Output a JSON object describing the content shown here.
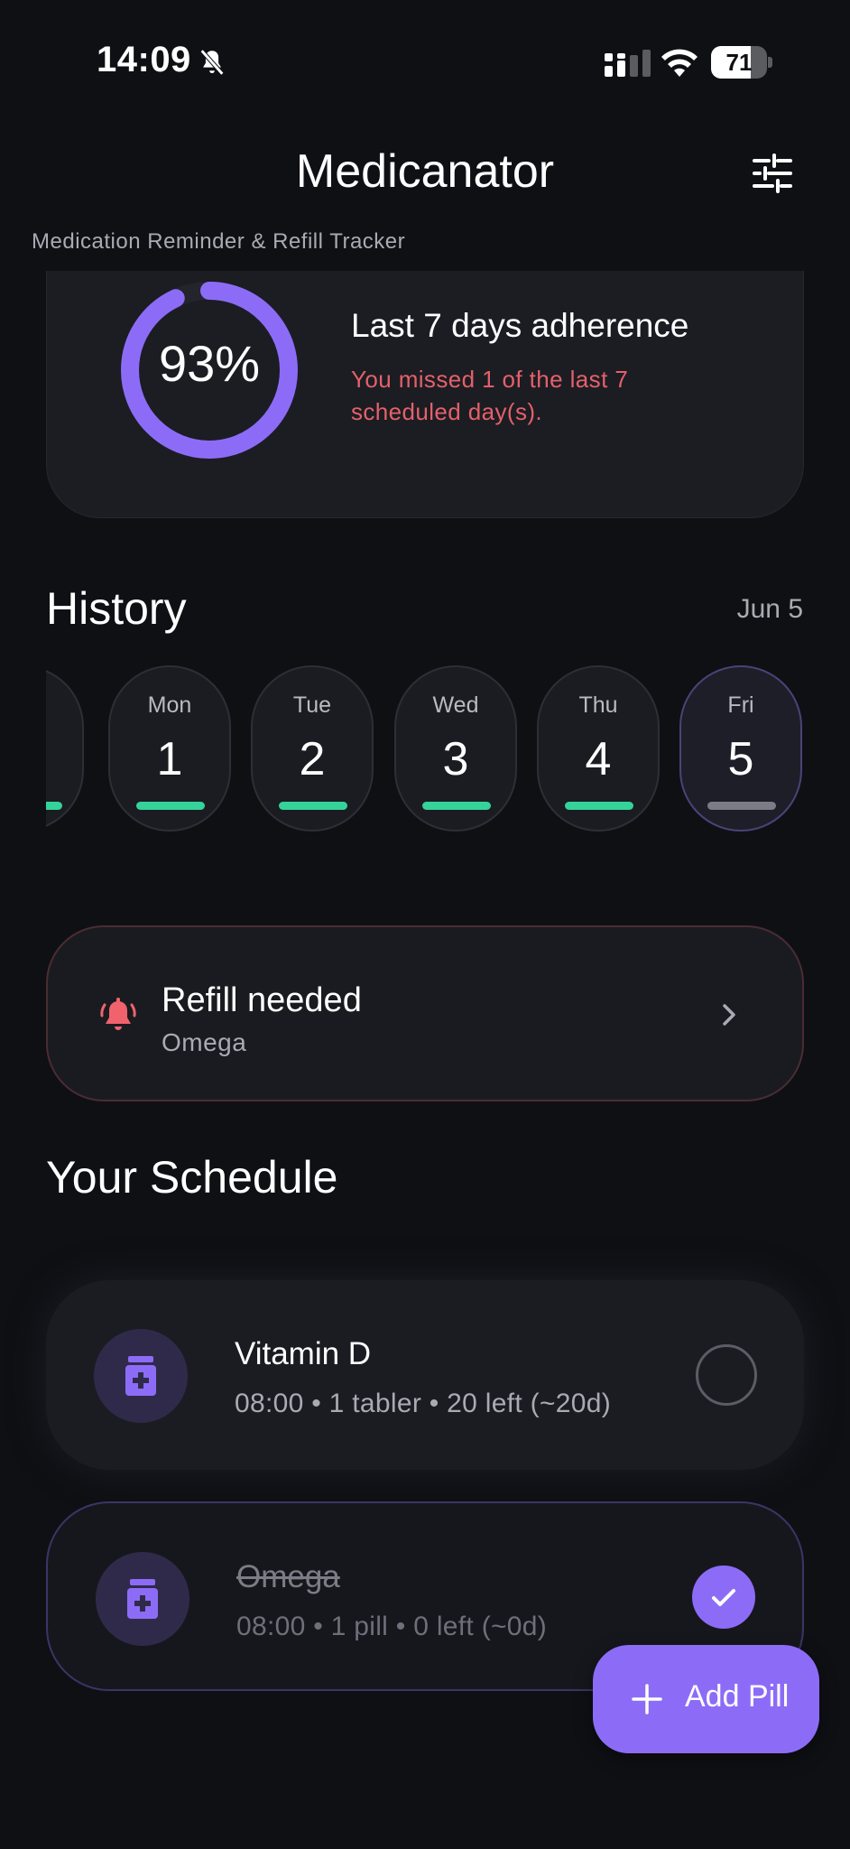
{
  "status_bar": {
    "time": "14:09",
    "battery": "71",
    "battery_level": 0.71,
    "icons": [
      "bell-slash-icon",
      "cellular-signal-icon",
      "wifi-icon",
      "battery-icon"
    ]
  },
  "header": {
    "title": "Medicanator",
    "subtitle": "Medication Reminder & Refill Tracker",
    "filter_icon": "sliders-icon"
  },
  "adherence": {
    "percent_label": "93%",
    "percent_value": 93,
    "title": "Last 7 days adherence",
    "message": "You missed 1 of the last 7 scheduled day(s).",
    "ring_color": "#8c6cf7"
  },
  "history": {
    "title": "History",
    "date_label": "Jun 5",
    "days": [
      {
        "name": "Mon",
        "num": "1",
        "status": "taken"
      },
      {
        "name": "Tue",
        "num": "2",
        "status": "taken"
      },
      {
        "name": "Wed",
        "num": "3",
        "status": "taken"
      },
      {
        "name": "Thu",
        "num": "4",
        "status": "taken"
      },
      {
        "name": "Fri",
        "num": "5",
        "status": "selected"
      }
    ]
  },
  "refill": {
    "title": "Refill needed",
    "medication": "Omega",
    "icon": "bell-ring-icon"
  },
  "schedule": {
    "title": "Your Schedule",
    "items": [
      {
        "name": "Vitamin D",
        "detail": "08:00 • 1 tabler • 20 left (~20d)",
        "taken": false
      },
      {
        "name": "Omega",
        "detail": "08:00 • 1 pill • 0 left (~0d)",
        "taken": true
      }
    ]
  },
  "fab": {
    "label": "Add Pill"
  },
  "colors": {
    "background": "#0f1014",
    "accent": "#8c6cf7",
    "success": "#35d29a",
    "warning": "#e5606a"
  }
}
